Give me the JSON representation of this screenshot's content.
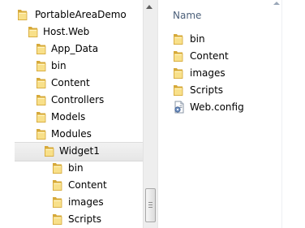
{
  "tree": {
    "items": [
      {
        "label": "PortableAreaDemo",
        "depth": 0
      },
      {
        "label": "Host.Web",
        "depth": 1
      },
      {
        "label": "App_Data",
        "depth": 2
      },
      {
        "label": "bin",
        "depth": 2
      },
      {
        "label": "Content",
        "depth": 2
      },
      {
        "label": "Controllers",
        "depth": 2
      },
      {
        "label": "Models",
        "depth": 2
      },
      {
        "label": "Modules",
        "depth": 2
      },
      {
        "label": "Widget1",
        "depth": 3,
        "selected": true
      },
      {
        "label": "bin",
        "depth": 4
      },
      {
        "label": "Content",
        "depth": 4
      },
      {
        "label": "images",
        "depth": 4
      },
      {
        "label": "Scripts",
        "depth": 4
      }
    ]
  },
  "list": {
    "column_header": "Name",
    "items": [
      {
        "label": "bin",
        "icon": "folder-icon"
      },
      {
        "label": "Content",
        "icon": "folder-icon"
      },
      {
        "label": "images",
        "icon": "folder-icon"
      },
      {
        "label": "Scripts",
        "icon": "folder-icon"
      },
      {
        "label": "Web.config",
        "icon": "config-file-icon"
      }
    ]
  },
  "colors": {
    "folder_light": "#f8e08a",
    "folder_dark": "#d6a93a",
    "header_text": "#4c607a",
    "selection": "#e8e8e8"
  }
}
